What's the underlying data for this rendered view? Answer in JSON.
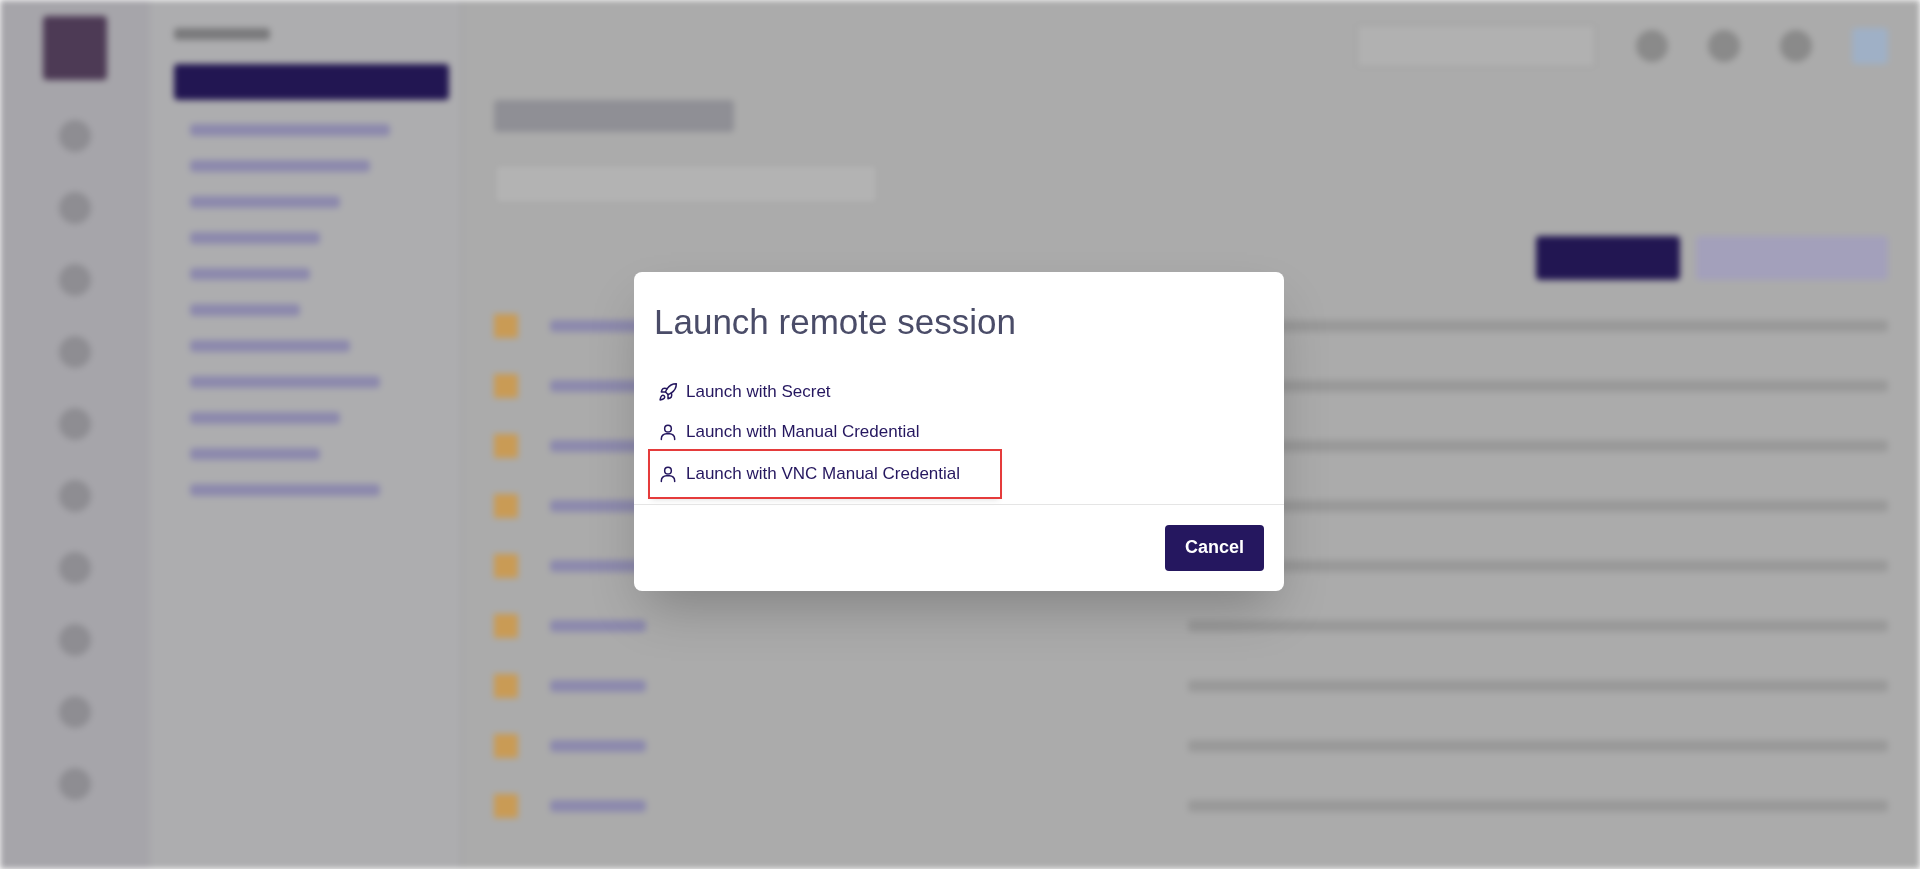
{
  "dialog": {
    "title": "Launch remote session",
    "options": [
      {
        "label": "Launch with Secret",
        "kind": "secret",
        "highlighted": false
      },
      {
        "label": "Launch with Manual Credential",
        "kind": "manual",
        "highlighted": false
      },
      {
        "label": "Launch with VNC Manual Credential",
        "kind": "manual",
        "highlighted": true
      }
    ],
    "buttons": [
      {
        "label": "Cancel"
      }
    ]
  }
}
